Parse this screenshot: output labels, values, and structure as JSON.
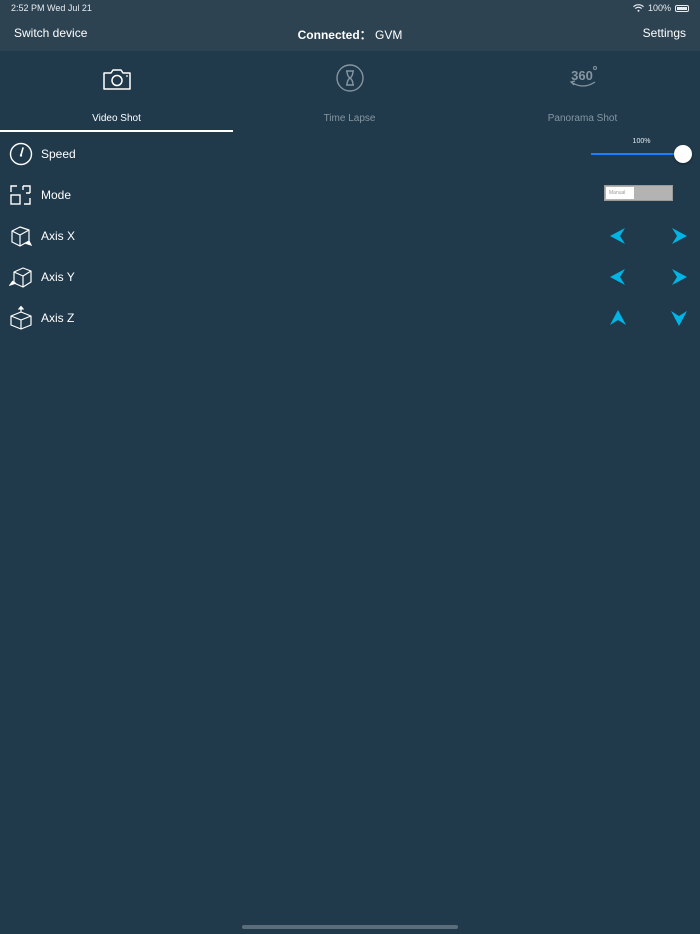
{
  "status_bar": {
    "time": "2:52 PM   Wed Jul 21",
    "battery": "100%",
    "wifi_icon": "wifi-icon",
    "battery_icon": "battery-icon"
  },
  "nav": {
    "left": "Switch device",
    "center_label": "Connected：",
    "center_value": "GVM",
    "right": "Settings"
  },
  "tabs": [
    {
      "label": "Video Shot",
      "icon": "camera-icon",
      "active": true
    },
    {
      "label": "Time Lapse",
      "icon": "hourglass-icon",
      "active": false
    },
    {
      "label": "Panorama Shot",
      "icon": "panorama-360-icon",
      "active": false
    }
  ],
  "rows": {
    "speed": {
      "label": "Speed",
      "icon": "speedometer-icon",
      "value_text": "100%",
      "value": 100
    },
    "mode": {
      "label": "Mode",
      "icon": "mode-icon",
      "option": "Manual"
    },
    "axis_x": {
      "label": "Axis X",
      "icon": "axis-x-cube-icon"
    },
    "axis_y": {
      "label": "Axis Y",
      "icon": "axis-y-cube-icon"
    },
    "axis_z": {
      "label": "Axis Z",
      "icon": "axis-z-cube-icon"
    }
  },
  "colors": {
    "background": "#203a4b",
    "bar": "#2e4352",
    "accent": "#00b4e6",
    "slider": "#1d7cff"
  }
}
